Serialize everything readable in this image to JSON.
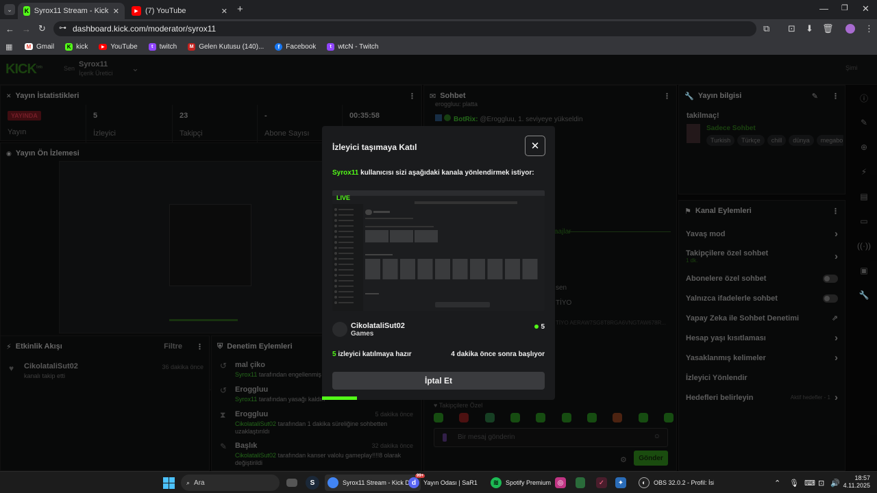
{
  "browser": {
    "tabs": [
      {
        "label": "Syrox11 Stream - Kick Dashboa",
        "close": "✕"
      },
      {
        "label": "(7) YouTube",
        "close": "✕"
      }
    ],
    "new_tab": "+",
    "url": "dashboard.kick.com/moderator/syrox11",
    "bookmarks": [
      "Gmail",
      "kick",
      "YouTube",
      "twitch",
      "Gelen Kutusu (140)...",
      "Facebook",
      "wtcN - Twitch"
    ]
  },
  "header": {
    "logo": "KICK",
    "badge": "beta",
    "role": "Sen",
    "channel_name": "Syrox11",
    "channel_role": "İçerik Üretici",
    "right": "Şimi"
  },
  "stats_panel": {
    "title": "Yayın İstatistikleri",
    "live_badge": "YAYINDA",
    "live_label": "Yayın",
    "stats": [
      {
        "value": "5",
        "label": "İzleyici"
      },
      {
        "value": "23",
        "label": "Takipçi"
      },
      {
        "value": "-",
        "label": "Abone Sayısı"
      },
      {
        "value": "00:35:58",
        "label": ""
      }
    ]
  },
  "preview_panel": {
    "title": "Yayın Ön İzlemesi"
  },
  "activity_panel": {
    "title": "Etkinlik Akışı",
    "filter": "Filtre",
    "items": [
      {
        "user": "CikolataliSut02",
        "text": "kanalı takip etti",
        "time": "36 dakika önce"
      }
    ]
  },
  "moderation_panel": {
    "title": "Denetim Eylemleri",
    "items": [
      {
        "target": "mal çiko",
        "actor": "Syrox11",
        "text": "tarafından engellenmiş b",
        "time": ""
      },
      {
        "target": "Eroggluu",
        "actor": "Syrox11",
        "text": "tarafından yasağı kaldırı",
        "time": ""
      },
      {
        "target": "Eroggluu",
        "actor": "CikolataliSut02",
        "text": "tarafından 1 dakika süreliğine sohbetten uzaklaştırıldı",
        "time": "5 dakika önce"
      },
      {
        "target": "Başlık",
        "actor": "CikolataliSut02",
        "text": "tarafından kanser valolu gameplay!!!!8 olarak değiştirildi",
        "highlight": "kanser valolu gameplay!!!!8",
        "time": "32 dakika önce"
      }
    ]
  },
  "chat_panel": {
    "title": "Sohbet",
    "top_line": "eroggluu: platta",
    "bot_name": "BotRix:",
    "bot_msg": "@Eroggluu, 1. seviyeye yükseldin",
    "fragments": [
      "aajlar",
      "sen",
      "TİYO",
      "TİYO AERAW7SG8T8RGA6VNGTAW678R..."
    ],
    "followers_only": "Takipçilere Özel",
    "placeholder": "Bir mesaj gönderin",
    "send": "Gönder"
  },
  "info_panel": {
    "title": "Yayın bilgisi",
    "stream_title": "takilmaç!",
    "category": "Sadece Sohbet",
    "tags": [
      "Turkish",
      "Türkçe",
      "chill",
      "dünya",
      "megabo"
    ]
  },
  "actions_panel": {
    "title": "Kanal Eylemleri",
    "rows": [
      {
        "label": "Yavaş mod",
        "sub": "",
        "control": "chevron"
      },
      {
        "label": "Takipçilere özel sohbet",
        "sub": "1 dk.",
        "control": "chevron"
      },
      {
        "label": "Abonelere özel sohbet",
        "sub": "",
        "control": "toggle"
      },
      {
        "label": "Yalnızca ifadelerle sohbet",
        "sub": "",
        "control": "toggle"
      },
      {
        "label": "Yapay Zeka ile Sohbet Denetimi",
        "sub": "",
        "control": "external"
      },
      {
        "label": "Hesap yaşı kısıtlaması",
        "sub": "",
        "control": "chevron"
      },
      {
        "label": "Yasaklanmış kelimeler",
        "sub": "",
        "control": "chevron"
      },
      {
        "label": "İzleyici Yönlendir",
        "sub": "",
        "control": "none"
      },
      {
        "label": "Hedefleri belirleyin",
        "sub": "Aktif hedefler - 1",
        "control": "chevron"
      }
    ]
  },
  "modal": {
    "title": "İzleyici taşımaya Katıl",
    "close": "✕",
    "user": "Syrox11",
    "message": " kullanıcısı sizi aşağıdaki kanala yönlendirmek istiyor:",
    "live": "LIVE",
    "target_channel": "CikolataliSut02",
    "target_category": "Games",
    "viewer_count": "5",
    "ready_count": "5",
    "ready_text": " izleyici katılmaya hazır",
    "starts_text": "4 dakika önce sonra başlıyor",
    "cancel": "İptal Et",
    "progress": 0.15,
    "accent": "#53fc18"
  },
  "taskbar": {
    "search": "Ara",
    "items": [
      "Syrox11 Stream - Kick Da",
      "Yayın Odası | SaR1",
      "Spotify Premium",
      "OBS 32.0.2 - Profil: İsims"
    ],
    "discord_badge": "99+",
    "time": "18:57",
    "date": "4.11.2025"
  }
}
